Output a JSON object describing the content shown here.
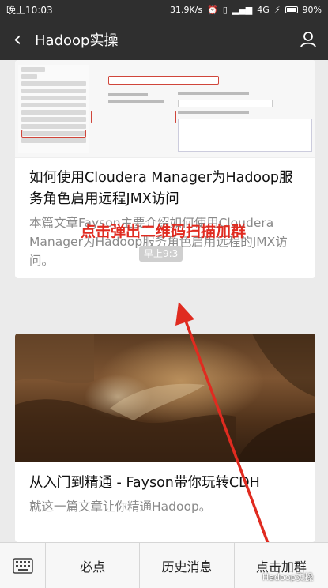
{
  "status_bar": {
    "time": "晚上10:03",
    "network_speed": "31.9K/s",
    "network_type": "4G",
    "battery": "90%",
    "icons": [
      "alarm-icon",
      "vibrate-icon",
      "signal-icon",
      "charging-icon",
      "battery-icon"
    ]
  },
  "nav": {
    "title": "Hadoop实操",
    "back_icon": "chevron-left-icon",
    "profile_icon": "user-icon"
  },
  "articles": [
    {
      "title": "如何使用Cloudera Manager为Hadoop服务角色启用远程JMX访问",
      "description": "本篇文章Fayson主要介绍如何使用Cloudera Manager为Hadoop服务角色启用远程的JMX访问。"
    },
    {
      "title": "从入门到精通 - Fayson带你玩转CDH",
      "description": "就这一篇文章让你精通Hadoop。"
    }
  ],
  "annotation": {
    "text": "点击弹出二维码扫描加群",
    "timestamp": "早上9:3"
  },
  "menu": {
    "keyboard_icon": "keyboard-icon",
    "items": [
      "必点",
      "历史消息",
      "点击加群"
    ]
  },
  "watermark": "Hadoop实操",
  "colors": {
    "header": "#2f2f2f",
    "annotation": "#e02b20"
  }
}
